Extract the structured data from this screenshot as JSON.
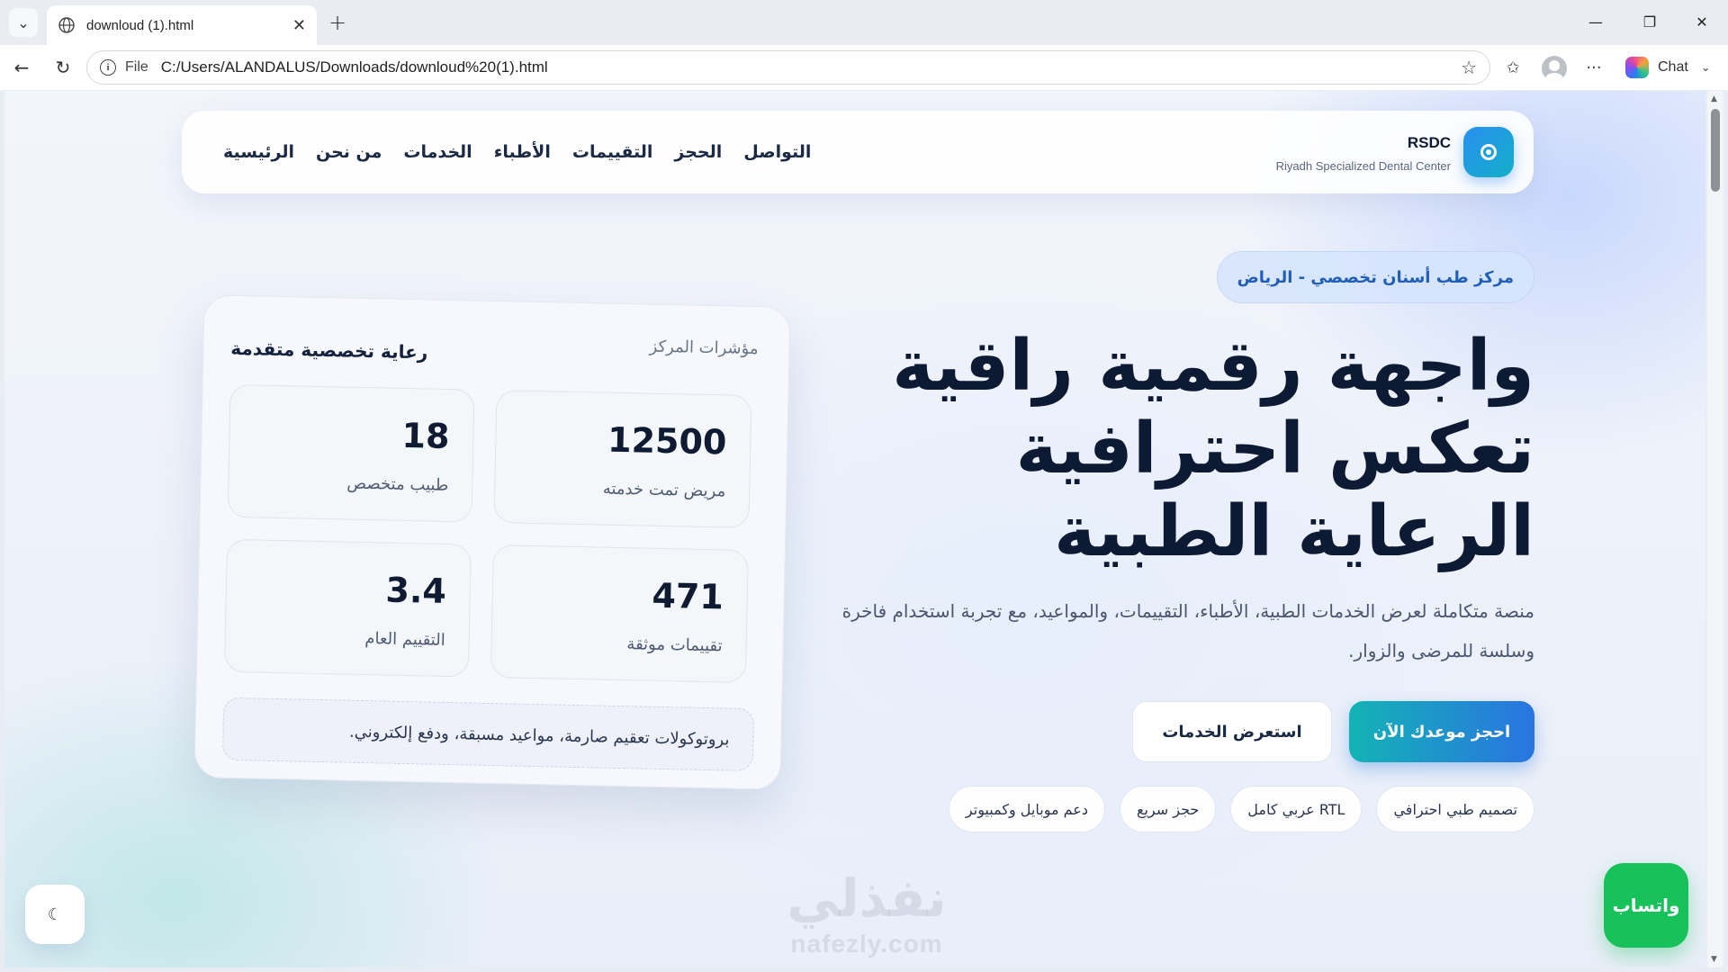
{
  "browser": {
    "tab_title": "downloud (1).html",
    "url_scheme": "File",
    "url": "C:/Users/ALANDALUS/Downloads/downloud%20(1).html",
    "chat_label": "Chat"
  },
  "brand": {
    "name": "RSDC",
    "subtitle": "Riyadh Specialized Dental Center"
  },
  "nav": {
    "items": [
      "الرئيسية",
      "من نحن",
      "الخدمات",
      "الأطباء",
      "التقييمات",
      "الحجز",
      "التواصل"
    ]
  },
  "hero": {
    "badge": "مركز طب أسنان تخصصي - الرياض",
    "title_lines": [
      "واجهة رقمية راقية",
      "تعكس احترافية",
      "الرعاية الطبية"
    ],
    "description": "منصة متكاملة لعرض الخدمات الطبية، الأطباء، التقييمات، والمواعيد، مع تجربة استخدام فاخرة وسلسة للمرضى والزوار.",
    "primary_button": "احجز موعدك الآن",
    "secondary_button": "استعرض الخدمات",
    "chips": [
      "تصميم طبي احترافي",
      "RTL عربي كامل",
      "حجز سريع",
      "دعم موبايل وكمبيوتر"
    ]
  },
  "stats_card": {
    "label": "مؤشرات المركز",
    "heading": "رعاية تخصصية متقدمة",
    "stats": [
      {
        "value": "12500",
        "label": "مريض تمت خدمته"
      },
      {
        "value": "18",
        "label": "طبيب متخصص"
      },
      {
        "value": "471",
        "label": "تقييمات موثقة"
      },
      {
        "value": "3.4",
        "label": "التقييم العام"
      }
    ],
    "note": "بروتوكولات تعقيم صارمة، مواعيد مسبقة، ودفع إلكتروني."
  },
  "floating": {
    "theme_toggle": "☾",
    "whatsapp": "واتساب"
  },
  "watermark": {
    "arabic": "نفذلي",
    "latin": "nafezly.com"
  },
  "colors": {
    "accent_blue": "#2a74e0",
    "accent_teal": "#13b3b6",
    "whatsapp_green": "#18c25a",
    "text_dark": "#0d1a33"
  }
}
